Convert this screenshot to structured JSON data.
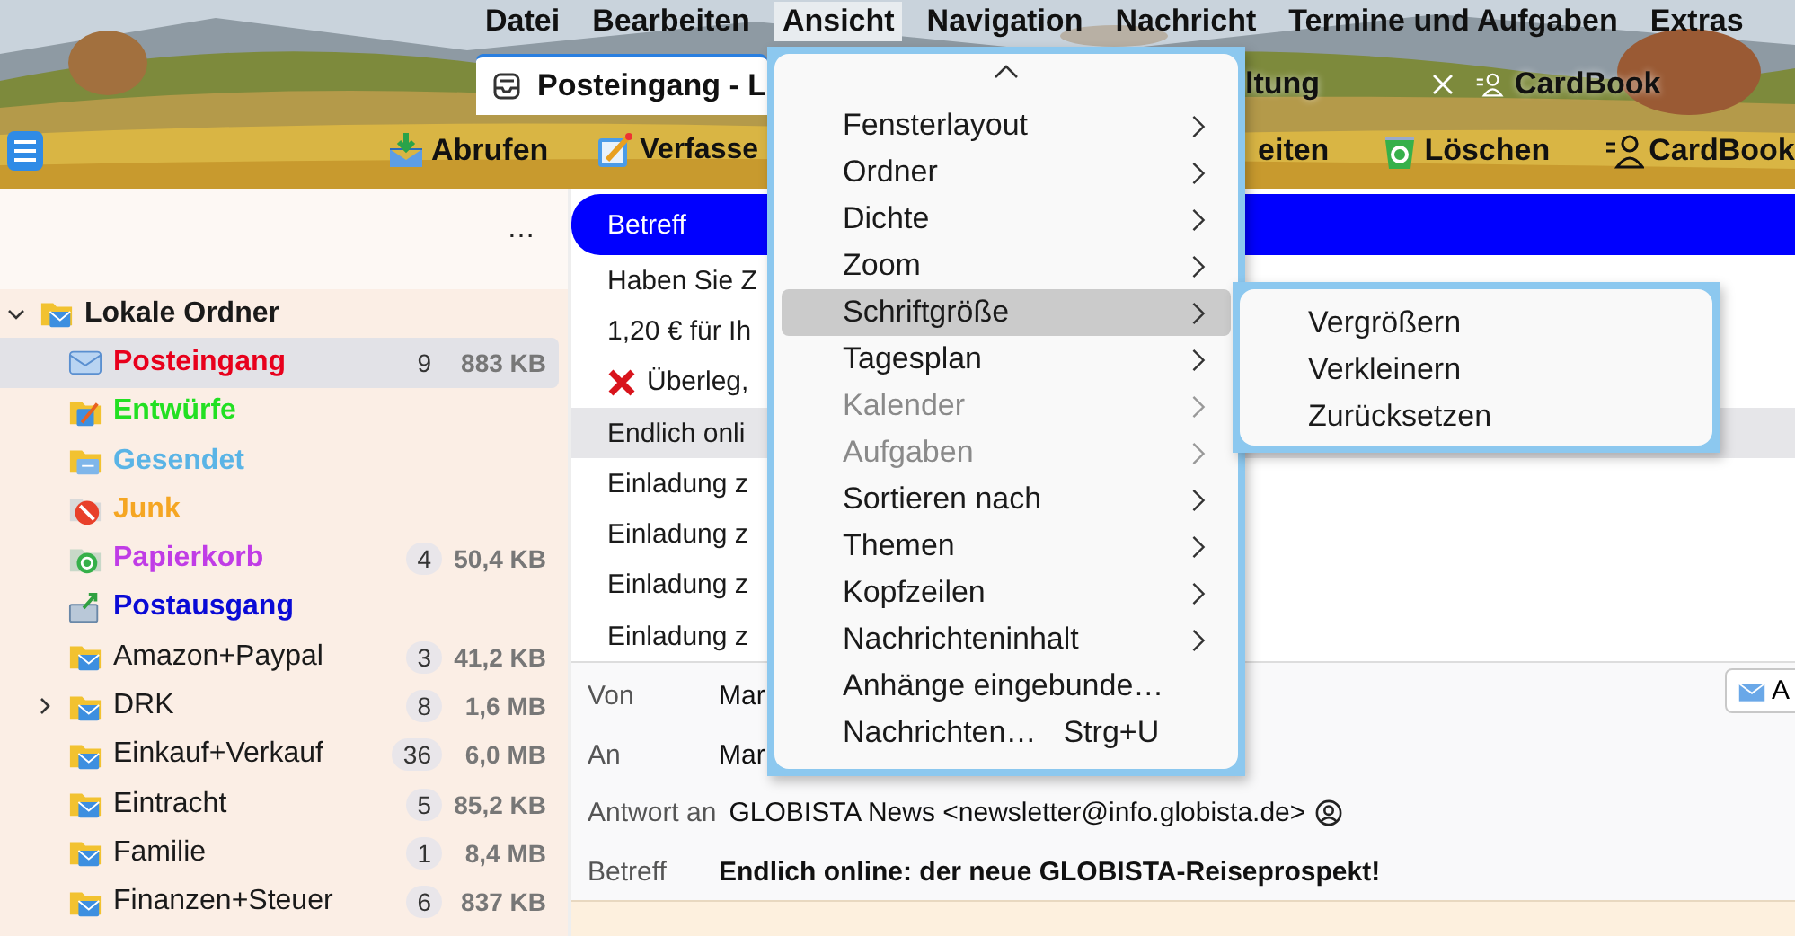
{
  "menubar": [
    {
      "label": "Datei",
      "selected": false
    },
    {
      "label": "Bearbeiten",
      "selected": false
    },
    {
      "label": "Ansicht",
      "selected": true
    },
    {
      "label": "Navigation",
      "selected": false
    },
    {
      "label": "Nachricht",
      "selected": false
    },
    {
      "label": "Termine und Aufgaben",
      "selected": false
    },
    {
      "label": "Extras",
      "selected": false
    }
  ],
  "tabs": [
    {
      "label": "Posteingang - L",
      "kind": "mail",
      "selected": true,
      "closable": false
    },
    {
      "label": "ltung",
      "kind": "plain",
      "selected": false,
      "closable": true
    },
    {
      "label": "CardBook",
      "kind": "contacts",
      "selected": false,
      "closable": false
    }
  ],
  "toolbar": [
    {
      "label": "Abrufen",
      "kind": "get"
    },
    {
      "label": "Verfasse",
      "kind": "write"
    },
    {
      "label": "eiten",
      "kind": "plain"
    },
    {
      "label": "Löschen",
      "kind": "delete"
    },
    {
      "label": "CardBook",
      "kind": "contacts"
    }
  ],
  "folder_pane": {
    "more": "…",
    "accounts": [
      {
        "name": "Lokale Ordner",
        "expanded": true,
        "children": [
          {
            "name": "Posteingang",
            "kind": "inbox",
            "color": "#e8001c",
            "selected": true,
            "unread": "9",
            "size": "883 KB"
          },
          {
            "name": "Entwürfe",
            "kind": "drafts",
            "color": "#22e022",
            "selected": false
          },
          {
            "name": "Gesendet",
            "kind": "sent",
            "color": "#5ab4e6",
            "selected": false
          },
          {
            "name": "Junk",
            "kind": "junk",
            "color": "#f5a623",
            "selected": false
          },
          {
            "name": "Papierkorb",
            "kind": "trash",
            "color": "#c03ce6",
            "selected": false,
            "unread": "4",
            "size": "50,4 KB"
          },
          {
            "name": "Postausgang",
            "kind": "outbox",
            "color": "#0a0ad6",
            "selected": false
          },
          {
            "name": "Amazon+Paypal",
            "kind": "folder",
            "selected": false,
            "unread": "3",
            "size": "41,2 KB"
          },
          {
            "name": "DRK",
            "kind": "folder",
            "selected": false,
            "expanded": false,
            "unread": "8",
            "size": "1,6 MB"
          },
          {
            "name": "Einkauf+Verkauf",
            "kind": "folder",
            "selected": false,
            "unread": "36",
            "size": "6,0 MB"
          },
          {
            "name": "Eintracht",
            "kind": "folder",
            "selected": false,
            "unread": "5",
            "size": "85,2 KB"
          },
          {
            "name": "Familie",
            "kind": "folder",
            "selected": false,
            "unread": "1",
            "size": "8,4 MB"
          },
          {
            "name": "Finanzen+Steuer",
            "kind": "folder",
            "selected": false,
            "unread": "6",
            "size": "837 KB"
          }
        ]
      }
    ]
  },
  "message_list": {
    "column": "Betreff",
    "rows": [
      {
        "subject": "Haben Sie Z",
        "kind": "normal",
        "selected": false
      },
      {
        "subject": "1,20 € für Ih",
        "kind": "normal",
        "selected": false
      },
      {
        "subject": "Überleg,",
        "kind": "deleted",
        "selected": false
      },
      {
        "subject": "Endlich onli",
        "kind": "normal",
        "selected": true
      },
      {
        "subject": "Einladung z",
        "kind": "normal",
        "selected": false
      },
      {
        "subject": "Einladung z",
        "kind": "normal",
        "selected": false
      },
      {
        "subject": "Einladung z",
        "kind": "normal",
        "selected": false
      },
      {
        "subject": "Einladung z",
        "kind": "normal",
        "selected": false
      }
    ]
  },
  "header_pane": {
    "action_button": "A",
    "fields": [
      {
        "label": "Von",
        "value": "Mar",
        "kind": "plain"
      },
      {
        "label": "An",
        "value": "Mar",
        "kind": "plain"
      },
      {
        "label": "Antwort an",
        "value": "GLOBISTA News <newsletter@info.globista.de>",
        "kind": "contact"
      },
      {
        "label": "Betreff",
        "value": "Endlich online: der neue GLOBISTA-Reiseprospekt!",
        "kind": "subject"
      }
    ]
  },
  "menu": {
    "items": [
      {
        "label": "Fensterlayout",
        "submenu": true,
        "selected": false,
        "disabled": false
      },
      {
        "label": "Ordner",
        "submenu": true,
        "selected": false,
        "disabled": false
      },
      {
        "label": "Dichte",
        "submenu": true,
        "selected": false,
        "disabled": false
      },
      {
        "label": "Zoom",
        "submenu": true,
        "selected": false,
        "disabled": false
      },
      {
        "label": "Schriftgröße",
        "submenu": true,
        "selected": true,
        "disabled": false
      },
      {
        "label": "Tagesplan",
        "submenu": true,
        "selected": false,
        "disabled": false
      },
      {
        "label": "Kalender",
        "submenu": true,
        "selected": false,
        "disabled": true
      },
      {
        "label": "Aufgaben",
        "submenu": true,
        "selected": false,
        "disabled": true
      },
      {
        "label": "Sortieren nach",
        "submenu": true,
        "selected": false,
        "disabled": false
      },
      {
        "label": "Themen",
        "submenu": true,
        "selected": false,
        "disabled": false
      },
      {
        "label": "Kopfzeilen",
        "submenu": true,
        "selected": false,
        "disabled": false
      },
      {
        "label": "Nachrichteninhalt",
        "submenu": true,
        "selected": false,
        "disabled": false
      },
      {
        "label": "Anhänge eingebunde…",
        "submenu": false,
        "selected": false,
        "disabled": false
      },
      {
        "label": "Nachrichten…",
        "shortcut": "Strg+U",
        "submenu": false,
        "selected": false,
        "disabled": false
      }
    ]
  },
  "submenu": {
    "items": [
      {
        "label": "Vergrößern"
      },
      {
        "label": "Verkleinern"
      },
      {
        "label": "Zurücksetzen"
      }
    ]
  }
}
